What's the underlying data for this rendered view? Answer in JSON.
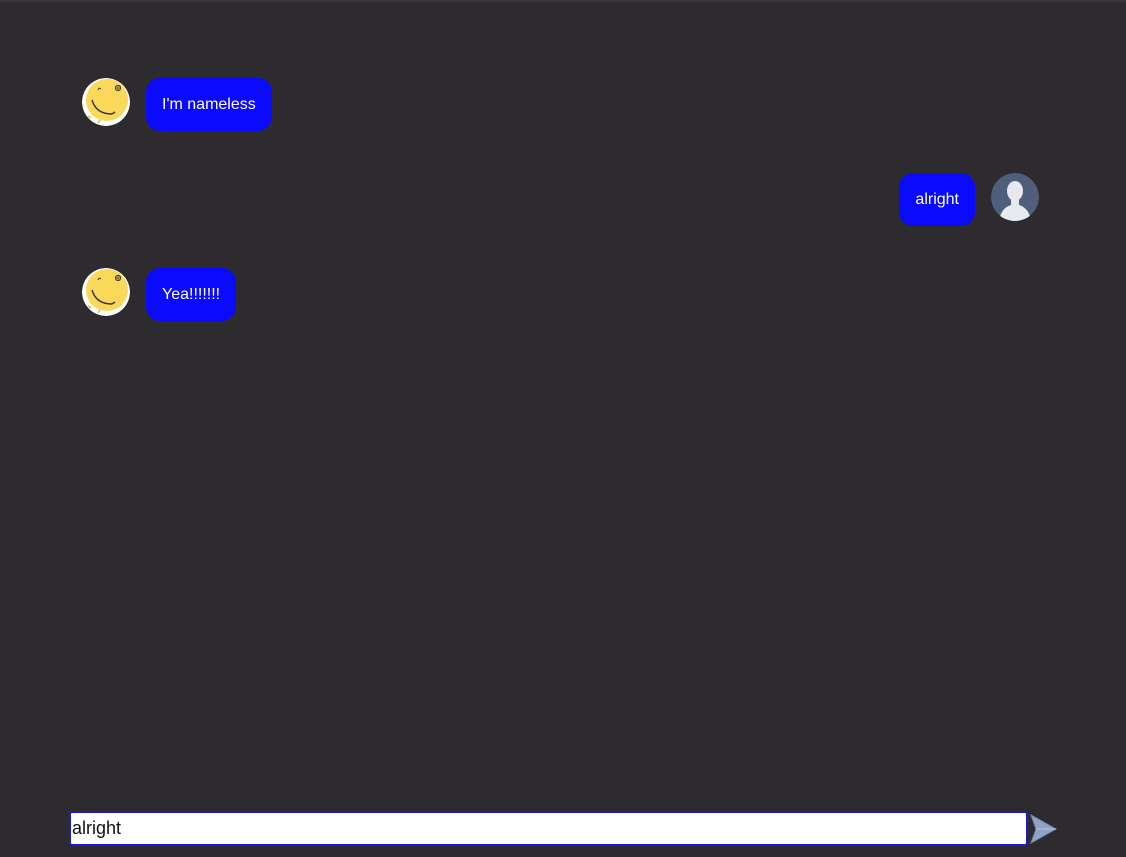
{
  "messages": [
    {
      "sender": "bot",
      "text": "I'm nameless",
      "avatar_icon": "smiley-face-icon"
    },
    {
      "sender": "user",
      "text": "alright",
      "avatar_icon": "user-silhouette-icon"
    },
    {
      "sender": "bot",
      "text": "Yea!!!!!!!",
      "avatar_icon": "smiley-face-icon"
    }
  ],
  "composer": {
    "value": "alright",
    "send_icon": "send-arrow-icon"
  },
  "colors": {
    "background": "#2d2b2e",
    "bubble": "#0a0aff",
    "bubble_text": "#ffffff",
    "bot_avatar": "#f9d85a",
    "user_avatar": "#4f5e7b",
    "input_border": "#1a1ad0",
    "send_icon": "#8fa3c4"
  }
}
